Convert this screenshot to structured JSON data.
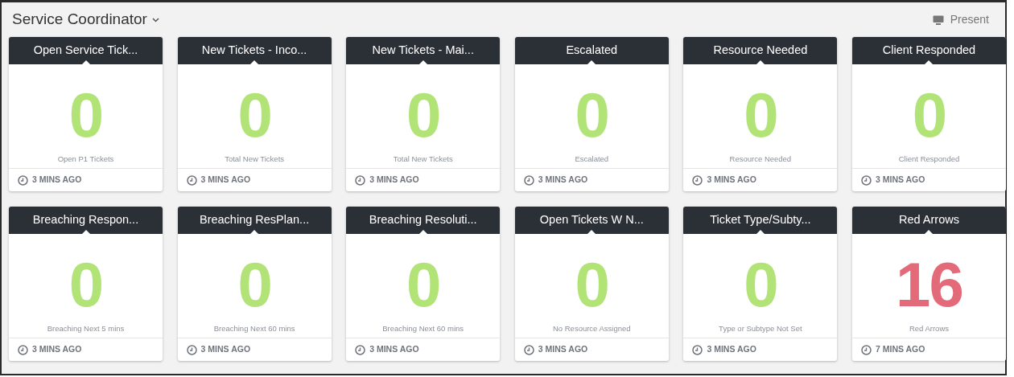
{
  "header": {
    "title": "Service Coordinator",
    "present_label": "Present"
  },
  "widgets": [
    {
      "title": "Open Service Tick...",
      "value": "0",
      "color": "#b1e377",
      "caption": "Open P1 Tickets",
      "updated": "3 MINS AGO"
    },
    {
      "title": "New Tickets - Inco...",
      "value": "0",
      "color": "#b1e377",
      "caption": "Total New Tickets",
      "updated": "3 MINS AGO"
    },
    {
      "title": "New Tickets - Mai...",
      "value": "0",
      "color": "#b1e377",
      "caption": "Total New Tickets",
      "updated": "3 MINS AGO"
    },
    {
      "title": "Escalated",
      "value": "0",
      "color": "#b1e377",
      "caption": "Escalated",
      "updated": "3 MINS AGO"
    },
    {
      "title": "Resource Needed",
      "value": "0",
      "color": "#b1e377",
      "caption": "Resource Needed",
      "updated": "3 MINS AGO"
    },
    {
      "title": "Client Responded",
      "value": "0",
      "color": "#b1e377",
      "caption": "Client Responded",
      "updated": "3 MINS AGO"
    },
    {
      "title": "Breaching Respon...",
      "value": "0",
      "color": "#b1e377",
      "caption": "Breaching Next 5 mins",
      "updated": "3 MINS AGO"
    },
    {
      "title": "Breaching ResPlan...",
      "value": "0",
      "color": "#b1e377",
      "caption": "Breaching Next 60 mins",
      "updated": "3 MINS AGO"
    },
    {
      "title": "Breaching Resoluti...",
      "value": "0",
      "color": "#b1e377",
      "caption": "Breaching Next 60 mins",
      "updated": "3 MINS AGO"
    },
    {
      "title": "Open Tickets W N...",
      "value": "0",
      "color": "#b1e377",
      "caption": "No Resource Assigned",
      "updated": "3 MINS AGO"
    },
    {
      "title": "Ticket Type/Subty...",
      "value": "0",
      "color": "#b1e377",
      "caption": "Type or Subtype Not Set",
      "updated": "3 MINS AGO"
    },
    {
      "title": "Red Arrows",
      "value": "16",
      "color": "#e36a78",
      "caption": "Red Arrows",
      "updated": "7 MINS AGO"
    }
  ]
}
